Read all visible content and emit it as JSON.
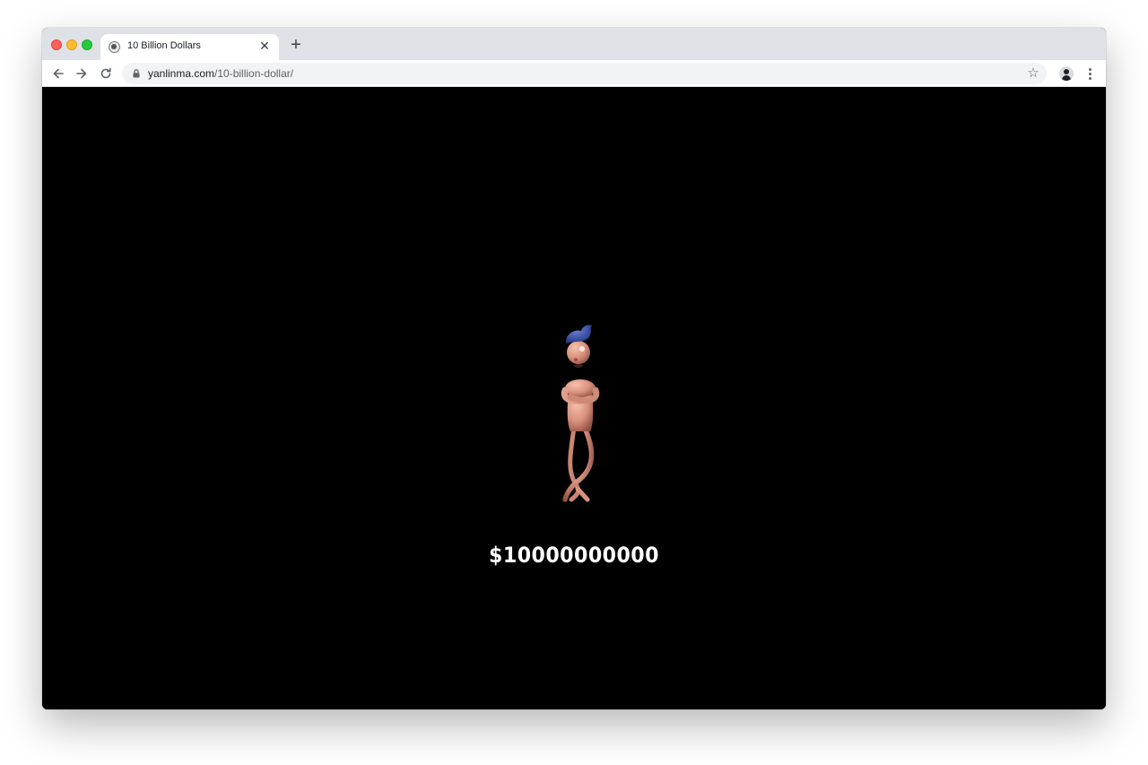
{
  "browser": {
    "tab": {
      "title": "10 Billion Dollars",
      "favicon": "globe-favicon-icon",
      "close_icon": "close-icon"
    },
    "new_tab_icon": "plus-icon",
    "toolbar": {
      "back_icon": "arrow-left-icon",
      "forward_icon": "arrow-right-icon",
      "reload_icon": "reload-icon",
      "lock_icon": "lock-icon",
      "url_host": "yanlinma.com",
      "url_path": "/10-billion-dollar/",
      "bookmark_icon": "star-icon",
      "profile_icon": "avatar-icon",
      "menu_icon": "kebab-menu-icon"
    },
    "colors": {
      "tabstrip": "#dee1e6",
      "page_background": "#000000",
      "close_red": "#fe5f57",
      "minimize_yellow": "#febc2e",
      "zoom_green": "#28c840"
    }
  },
  "page": {
    "character_image": "3d-pink-character-with-blue-hair",
    "amount_text": "$10000000000",
    "colors": {
      "text": "#ffffff",
      "character_skin": "#d9927e",
      "character_hair": "#3a4fa5"
    }
  }
}
